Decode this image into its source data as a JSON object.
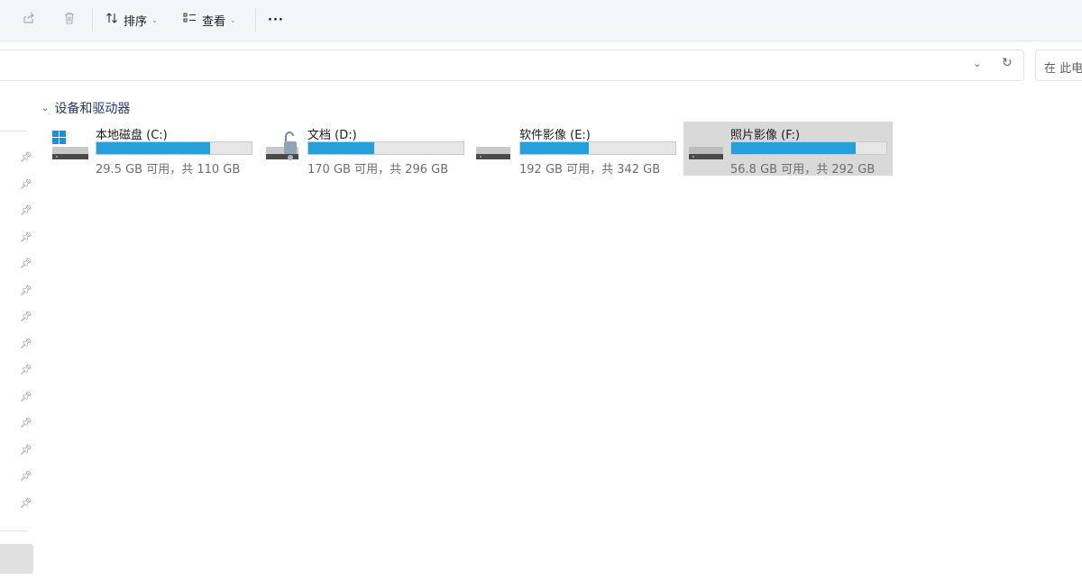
{
  "toolbar": {
    "share_icon": "share-icon",
    "delete_icon": "delete-icon",
    "sort_label": "排序",
    "view_label": "查看",
    "more_label": "···"
  },
  "address": {
    "dropdown_icon": "chevron-down-icon",
    "refresh_icon": "refresh-icon"
  },
  "search": {
    "placeholder": "在 此电"
  },
  "section": {
    "title": "设备和驱动器"
  },
  "drives": [
    {
      "name": "本地磁盘 (C:)",
      "free_text": "29.5 GB 可用，共 110 GB",
      "used_fraction": 0.732,
      "icon": "windows-drive-icon"
    },
    {
      "name": "文档 (D:)",
      "free_text": "170 GB 可用，共 296 GB",
      "used_fraction": 0.426,
      "icon": "locked-drive-icon"
    },
    {
      "name": "软件影像 (E:)",
      "free_text": "192 GB 可用，共 342 GB",
      "used_fraction": 0.439,
      "icon": "drive-icon"
    },
    {
      "name": "照片影像 (F:)",
      "free_text": "56.8 GB 可用，共 292 GB",
      "used_fraction": 0.805,
      "icon": "drive-icon"
    }
  ],
  "colors": {
    "bar_fill": "#26a0da",
    "bar_bg": "#e6e6e6",
    "selected_bg": "#d9d9d9"
  }
}
